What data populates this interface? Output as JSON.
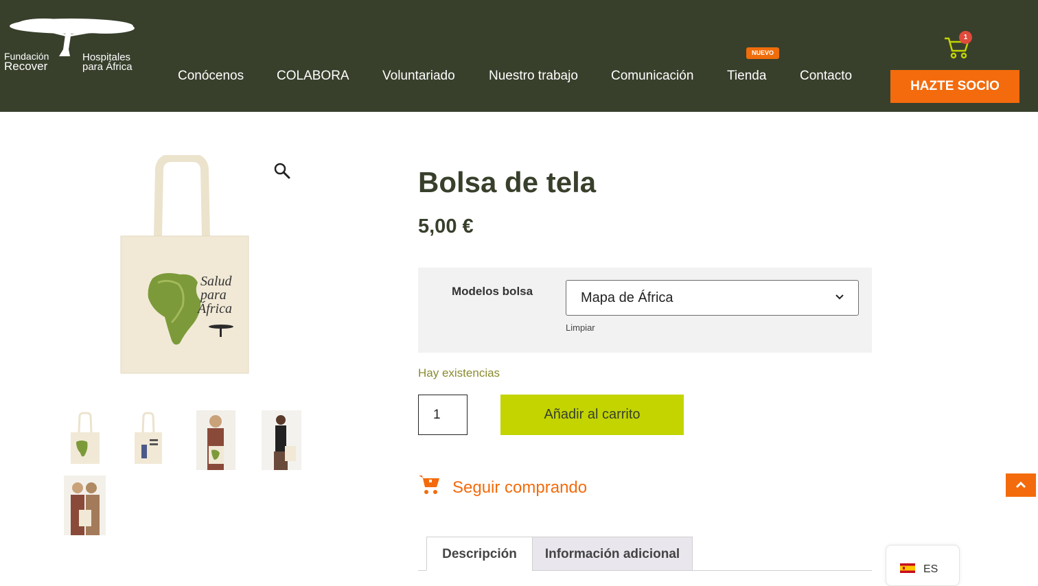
{
  "header": {
    "logo": {
      "line1": "Fundación",
      "line2": "Recover",
      "line3": "Hospitales",
      "line4": "para África"
    },
    "nav": [
      "Conócenos",
      "COLABORA",
      "Voluntariado",
      "Nuestro trabajo",
      "Comunicación",
      "Tienda",
      "Contacto"
    ],
    "nuevo_badge": "NUEVO",
    "cart_count": "1",
    "cta": "HAZTE SOCIO"
  },
  "gallery": {
    "main_image_text": [
      "Salud",
      "para",
      "África"
    ]
  },
  "product": {
    "title": "Bolsa de tela",
    "price": "5,00 €",
    "variation_label": "Modelos bolsa",
    "variation_value": "Mapa de África",
    "clear_label": "Limpiar",
    "stock": "Hay existencias",
    "quantity": "1",
    "add_to_cart": "Añadir al carrito",
    "continue_shopping": "Seguir comprando"
  },
  "tabs": [
    "Descripción",
    "Información adicional"
  ],
  "language": {
    "code": "ES"
  },
  "colors": {
    "header_bg": "#38402c",
    "accent_orange": "#f36b0c",
    "accent_lime": "#c3d400",
    "stock_text": "#8a8a2f"
  }
}
